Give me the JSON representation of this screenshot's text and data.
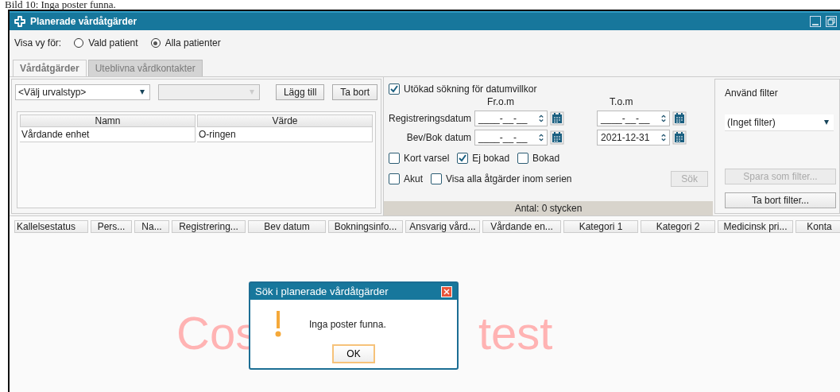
{
  "caption": "Bild 10: Inga poster funna.",
  "window": {
    "title": "Planerade vårdåtgärder"
  },
  "view_selector": {
    "label": "Visa vy för:",
    "options": [
      {
        "label": "Vald patient",
        "selected": false
      },
      {
        "label": "Alla patienter",
        "selected": true
      }
    ]
  },
  "tabs": [
    {
      "label": "Vårdåtgärder",
      "selected": true,
      "disabled": false
    },
    {
      "label": "Uteblivna vårdkontakter",
      "selected": false,
      "disabled": true
    }
  ],
  "criteria": {
    "type_dropdown": {
      "value": "<Välj urvalstyp>",
      "disabled": false
    },
    "value_dropdown": {
      "disabled": true
    },
    "buttons": [
      {
        "label": "Lägg till"
      },
      {
        "label": "Ta bort"
      }
    ],
    "table": {
      "columns": [
        "Namn",
        "Värde"
      ],
      "rows": [
        [
          "Vårdande enhet",
          "O-ringen"
        ]
      ]
    }
  },
  "date_search": {
    "extended": {
      "label": "Utökad sökning för datumvillkor",
      "checked": true
    },
    "from_label": "Fr.o.m",
    "to_label": "T.o.m",
    "rows": [
      {
        "label": "Registreringsdatum",
        "from": "____-__-__",
        "to": "____-__-__"
      },
      {
        "label": "Bev/Bok datum",
        "from": "____-__-__",
        "to": "2021-12-31"
      }
    ],
    "checkbox_rows": [
      [
        {
          "label": "Kort varsel",
          "checked": false
        },
        {
          "label": "Ej bokad",
          "checked": true
        },
        {
          "label": "Bokad",
          "checked": false
        }
      ],
      [
        {
          "label": "Akut",
          "checked": false
        },
        {
          "label": "Visa alla åtgärder inom serien",
          "checked": false
        }
      ]
    ],
    "search_button": {
      "label": "Sök",
      "disabled": true
    },
    "count": "Antal: 0 stycken"
  },
  "filter": {
    "label": "Använd filter",
    "dropdown": "(Inget filter)",
    "buttons": [
      {
        "label": "Spara som filter...",
        "disabled": true
      },
      {
        "label": "Ta bort filter...",
        "disabled": false
      }
    ]
  },
  "results": {
    "columns": [
      "Kallelsestatus",
      "Pers...",
      "Na...",
      "Registrering...",
      "Bev datum",
      "Bokningsinfo...",
      "Ansvarig vård...",
      "Vårdande en...",
      "Kategori 1",
      "Kategori 2",
      "Medicinsk pri...",
      "Konta"
    ]
  },
  "watermark": [
    "Cos",
    "test"
  ],
  "dialog": {
    "title": "Sök i planerade vårdåtgärder",
    "message": "Inga poster funna.",
    "button": "OK"
  }
}
